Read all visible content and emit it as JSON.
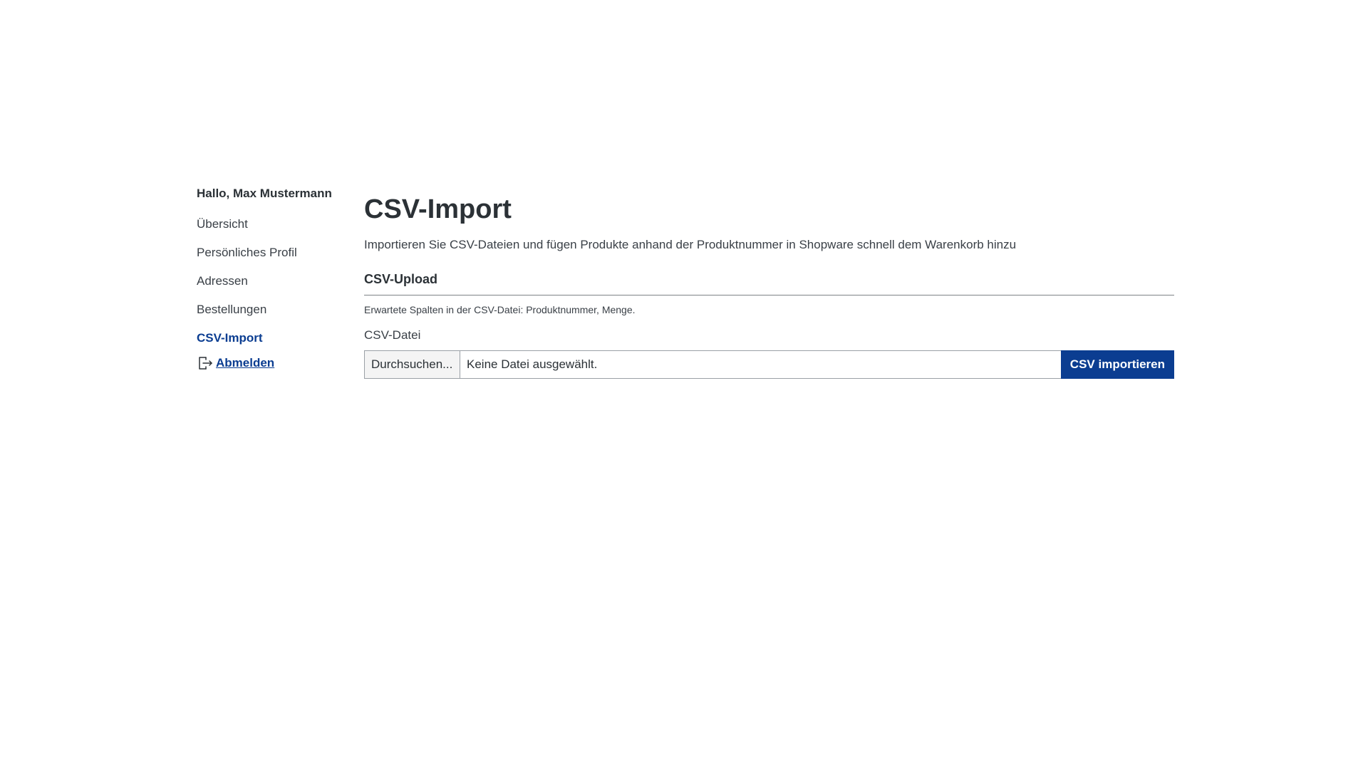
{
  "sidebar": {
    "greeting": "Hallo, Max Mustermann",
    "items": [
      {
        "label": "Übersicht"
      },
      {
        "label": "Persönliches Profil"
      },
      {
        "label": "Adressen"
      },
      {
        "label": "Bestellungen"
      },
      {
        "label": "CSV-Import"
      }
    ],
    "active_index": 4,
    "logout_label": "Abmelden",
    "logout_icon": "logout-icon"
  },
  "main": {
    "title": "CSV-Import",
    "intro": "Importieren Sie CSV-Dateien und fügen Produkte anhand der Produktnummer in Shopware schnell dem Warenkorb hinzu",
    "section_title": "CSV-Upload",
    "hint": "Erwartete Spalten in der CSV-Datei: Produktnummer, Menge.",
    "field_label": "CSV-Datei",
    "browse_label": "Durchsuchen...",
    "file_status": "Keine Datei ausgewählt.",
    "submit_label": "CSV importieren"
  },
  "colors": {
    "accent": "#0b3d91",
    "text": "#2b3136"
  }
}
